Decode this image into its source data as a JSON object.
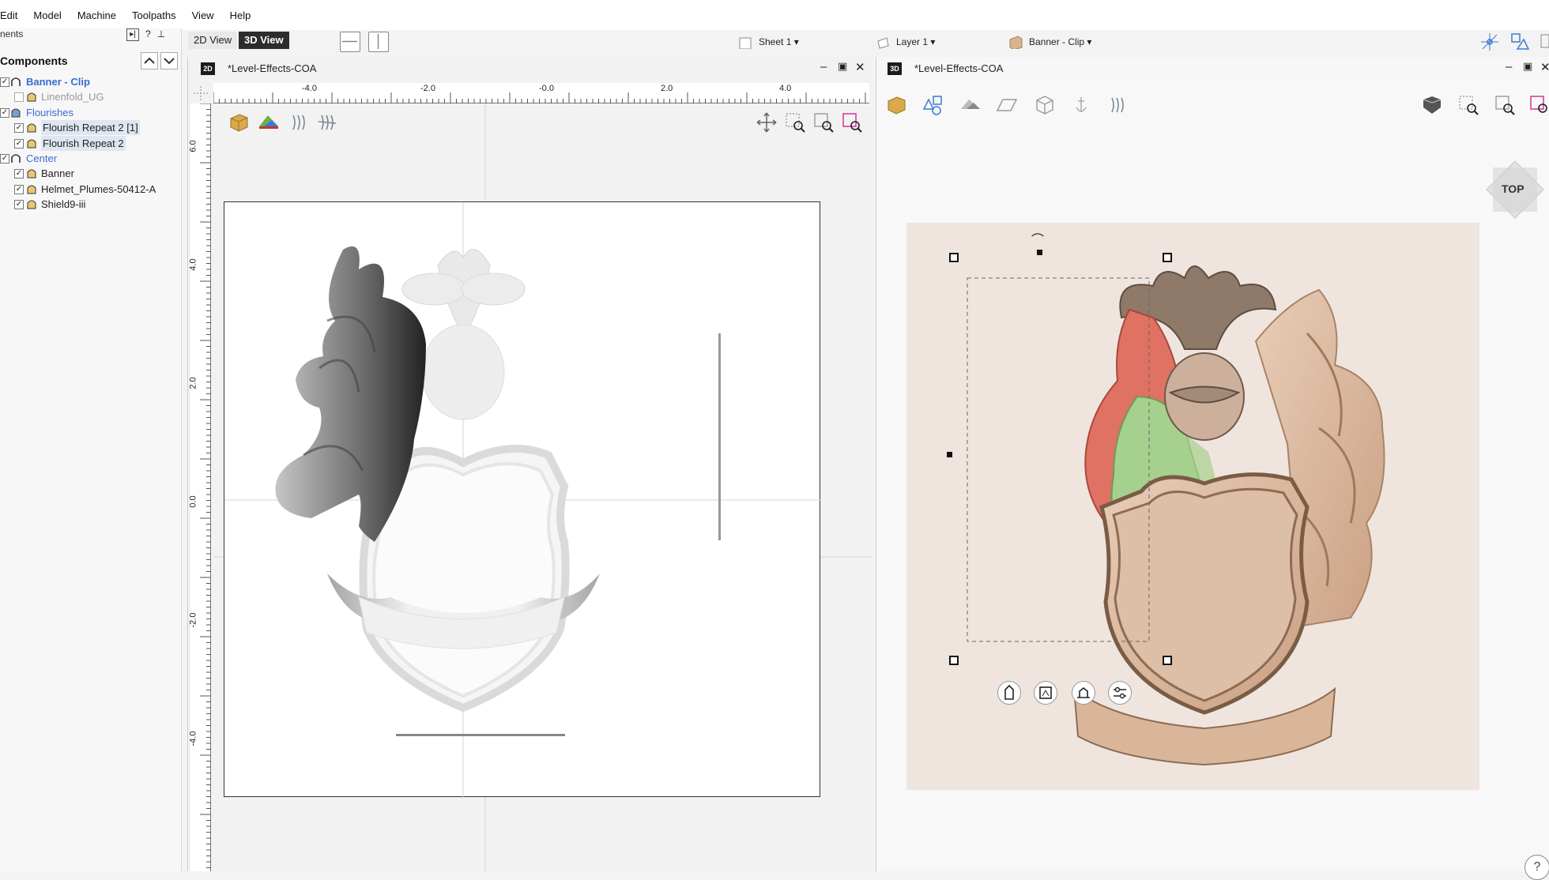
{
  "menu": [
    "Edit",
    "Model",
    "Machine",
    "Toolpaths",
    "View",
    "Help"
  ],
  "toolbar": {
    "view_2d": "2D View",
    "view_3d": "3D View",
    "sheet": "Sheet 1",
    "layer": "Layer 1",
    "component": "Banner - Clip"
  },
  "left_panel": {
    "title": "nents",
    "icons": [
      "pin-right-icon",
      "?",
      "pin-icon"
    ],
    "components_title": "Components",
    "tree": [
      {
        "label": "Banner - Clip",
        "level": 0,
        "group": true,
        "checked": true
      },
      {
        "label": "Linenfold_UG",
        "level": 1,
        "group": false,
        "checked": false,
        "dim": true
      },
      {
        "label": "Flourishes",
        "level": 0,
        "group": true,
        "checked": true
      },
      {
        "label": "Flourish Repeat 2 [1]",
        "level": 1,
        "group": false,
        "checked": true,
        "selected": true
      },
      {
        "label": "Flourish Repeat 2",
        "level": 1,
        "group": false,
        "checked": true,
        "selected": true
      },
      {
        "label": "Center",
        "level": 0,
        "group": true,
        "checked": true
      },
      {
        "label": "Banner",
        "level": 1,
        "group": false,
        "checked": true
      },
      {
        "label": "Helmet_Plumes-50412-A",
        "level": 1,
        "group": false,
        "checked": true
      },
      {
        "label": "Shield9-iii",
        "level": 1,
        "group": false,
        "checked": true
      }
    ]
  },
  "view2d": {
    "badge": "2D",
    "title": "*Level-Effects-COA",
    "ruler_h_labels": [
      "-4.0",
      "-2.0",
      "-0.0",
      "2.0",
      "4.0"
    ],
    "ruler_v_labels": [
      "6.0",
      "4.0",
      "2.0",
      "0.0",
      "-2.0",
      "-4.0"
    ]
  },
  "view3d": {
    "badge": "3D",
    "title": "*Level-Effects-COA",
    "top_label": "TOP",
    "help": "?"
  },
  "colors": {
    "accent_dark": "#2d2d2d",
    "group_blue": "#3a6bd1",
    "wood": "#d9b79c",
    "red_highlight": "#e07565",
    "green_highlight": "#9ccf85"
  }
}
